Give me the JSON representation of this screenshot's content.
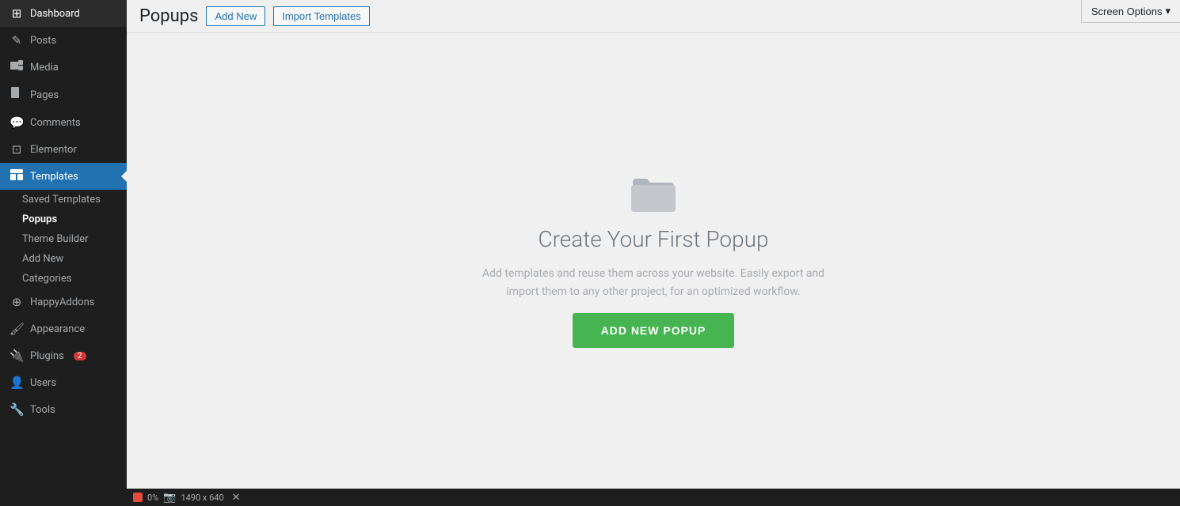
{
  "sidebar": {
    "items": [
      {
        "id": "dashboard",
        "label": "Dashboard",
        "icon": "⊞"
      },
      {
        "id": "posts",
        "label": "Posts",
        "icon": "✎"
      },
      {
        "id": "media",
        "label": "Media",
        "icon": "⊟"
      },
      {
        "id": "pages",
        "label": "Pages",
        "icon": "📄"
      },
      {
        "id": "comments",
        "label": "Comments",
        "icon": "💬"
      },
      {
        "id": "elementor",
        "label": "Elementor",
        "icon": "⊡"
      },
      {
        "id": "templates",
        "label": "Templates",
        "icon": "▤",
        "active": true
      },
      {
        "id": "happyaddons",
        "label": "HappyAddons",
        "icon": "⊕"
      },
      {
        "id": "appearance",
        "label": "Appearance",
        "icon": "🖌"
      },
      {
        "id": "plugins",
        "label": "Plugins",
        "icon": "🔌",
        "badge": "2"
      },
      {
        "id": "users",
        "label": "Users",
        "icon": "👤"
      },
      {
        "id": "tools",
        "label": "Tools",
        "icon": "🔧"
      }
    ],
    "submenu": [
      {
        "id": "saved-templates",
        "label": "Saved Templates"
      },
      {
        "id": "popups",
        "label": "Popups",
        "active": true
      },
      {
        "id": "theme-builder",
        "label": "Theme Builder"
      },
      {
        "id": "add-new",
        "label": "Add New"
      },
      {
        "id": "categories",
        "label": "Categories"
      }
    ]
  },
  "topbar": {
    "title": "Popups",
    "add_new_label": "Add New",
    "import_label": "Import Templates",
    "screen_options_label": "Screen Options"
  },
  "empty_state": {
    "heading": "Create Your First Popup",
    "description": "Add templates and reuse them across your website. Easily export and\nimport them to any other project, for an optimized workflow.",
    "button_label": "ADD NEW POPUP"
  },
  "bottombar": {
    "percent": "0%",
    "dimensions": "1490 x 640"
  },
  "colors": {
    "sidebar_bg": "#1e1e1e",
    "active_blue": "#2271b1",
    "green": "#46b450",
    "content_bg": "#f0f0f1"
  }
}
